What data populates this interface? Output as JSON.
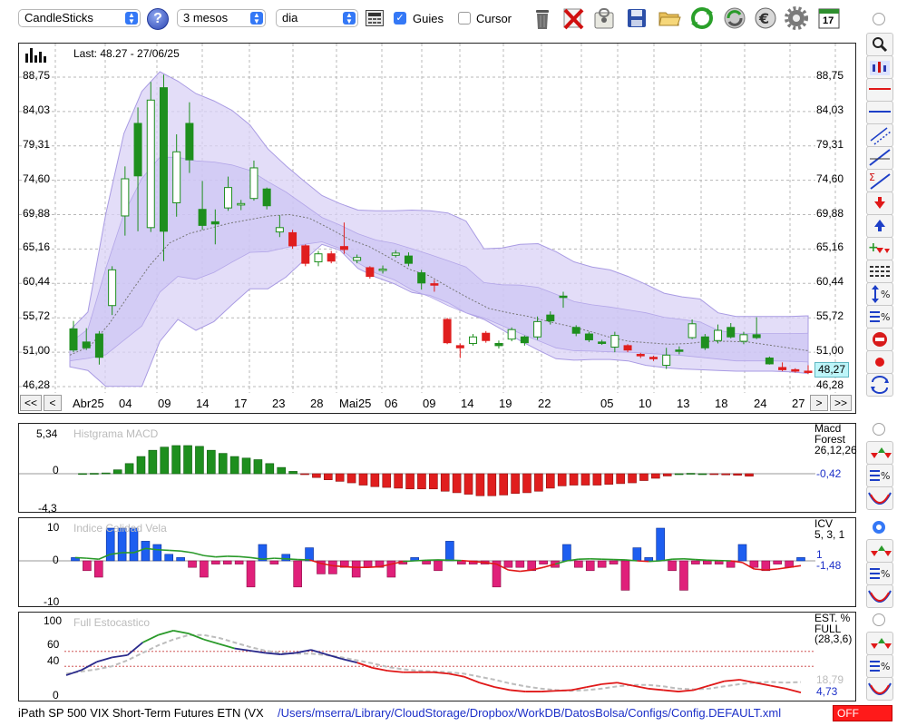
{
  "toolbar": {
    "chart_type": "CandleSticks",
    "period": "3 mesos",
    "interval": "dia",
    "guies_label": "Guies",
    "guies_checked": true,
    "cursor_label": "Cursor",
    "cursor_checked": false,
    "calendar_day": "17",
    "icons": [
      "help-icon",
      "calculator-icon",
      "trash-icon",
      "delete-icon",
      "lock-icon",
      "save-icon",
      "folder-icon",
      "refresh-icon",
      "sync-icon",
      "euro-icon",
      "settings-icon",
      "calendar-icon"
    ]
  },
  "main_panel": {
    "last_label": "Last: 48.27 - 27/06/25",
    "price_ticks": [
      "88,75",
      "84,03",
      "79,31",
      "74,60",
      "69,88",
      "65,16",
      "60,44",
      "55,72",
      "51,00",
      "46,28"
    ],
    "last_price_badge": "48,27",
    "date_labels": [
      "Abr25",
      "04",
      "09",
      "14",
      "17",
      "23",
      "28",
      "Mai25",
      "06",
      "09",
      "14",
      "19",
      "22",
      "05",
      "10",
      "13",
      "18",
      "24",
      "27"
    ],
    "nav": {
      "first": "<<",
      "prev": "<",
      "next": ">",
      "last": ">>"
    }
  },
  "macd_panel": {
    "title": "Histgrama MACD",
    "ticks": [
      "5,34",
      "0",
      "-4,3"
    ],
    "legend_name": "Macd Forest",
    "legend_params": "26,12,26",
    "legend_value": "-0,42"
  },
  "icv_panel": {
    "title": "Indice Calidad Vela",
    "ticks": [
      "10",
      "0",
      "-10"
    ],
    "legend_name": "ICV",
    "legend_params": "5, 3, 1",
    "value_1": "1",
    "value_2": "-1,48"
  },
  "stoch_panel": {
    "title": "Full Estocastico",
    "ticks": [
      "100",
      "60",
      "40",
      "0"
    ],
    "legend_name": "EST. %",
    "legend_type": "FULL",
    "legend_params": "(28,3,6)",
    "value_1": "18,79",
    "value_2": "4,73"
  },
  "status_bar": {
    "instrument": "iPath SP 500 VIX Short-Term Futures ETN (VX",
    "path": "/Users/mserra/Library/CloudStorage/Dropbox/WorkDB/DatosBolsa/Configs/Config.DEFAULT.xml",
    "badge": "OFF"
  },
  "colors": {
    "up": "#1e8f1e",
    "down": "#e01e1e",
    "band": "#d9d2f6",
    "band_edge": "#a99be3",
    "accent": "#3478f6"
  },
  "chart_data": [
    {
      "type": "candlestick",
      "title": "Last: 48.27 - 27/06/25",
      "ylim": [
        46.28,
        90.5
      ],
      "y_ticks": [
        88.75,
        84.03,
        79.31,
        74.6,
        69.88,
        65.16,
        60.44,
        55.72,
        51.0,
        46.28
      ],
      "x_tick_labels": [
        "Abr25",
        "04",
        "09",
        "14",
        "17",
        "23",
        "28",
        "Mai25",
        "06",
        "09",
        "14",
        "19",
        "22",
        "05",
        "10",
        "13",
        "18",
        "24",
        "27"
      ],
      "grid": true,
      "candles": [
        {
          "o": 51.3,
          "c": 54.2,
          "h": 55.3,
          "l": 51.0,
          "t": "g"
        },
        {
          "o": 51.6,
          "c": 52.4,
          "h": 54.3,
          "l": 51.3,
          "t": "g"
        },
        {
          "o": 50.3,
          "c": 53.5,
          "h": 53.9,
          "l": 49.3,
          "t": "g"
        },
        {
          "o": 57.4,
          "c": 62.3,
          "h": 62.8,
          "l": 56.1,
          "t": "w"
        },
        {
          "o": 69.7,
          "c": 74.8,
          "h": 76.5,
          "l": 67.0,
          "t": "w"
        },
        {
          "o": 75.2,
          "c": 82.4,
          "h": 84.6,
          "l": 67.6,
          "t": "g"
        },
        {
          "o": 68.1,
          "c": 85.6,
          "h": 88.1,
          "l": 67.5,
          "t": "w"
        },
        {
          "o": 67.6,
          "c": 87.3,
          "h": 89.1,
          "l": 63.5,
          "t": "g"
        },
        {
          "o": 71.5,
          "c": 78.5,
          "h": 80.9,
          "l": 69.6,
          "t": "w"
        },
        {
          "o": 77.4,
          "c": 82.4,
          "h": 85.3,
          "l": 75.6,
          "t": "g"
        },
        {
          "o": 68.4,
          "c": 70.6,
          "h": 74.5,
          "l": 67.8,
          "t": "g"
        },
        {
          "o": 68.6,
          "c": 68.9,
          "h": 70.6,
          "l": 65.8,
          "t": "g"
        },
        {
          "o": 70.8,
          "c": 73.6,
          "h": 75.1,
          "l": 70.4,
          "t": "w"
        },
        {
          "o": 71.2,
          "c": 71.4,
          "h": 71.9,
          "l": 70.5,
          "t": "w"
        },
        {
          "o": 72.1,
          "c": 76.3,
          "h": 77.3,
          "l": 71.8,
          "t": "w"
        },
        {
          "o": 73.4,
          "c": 71.1,
          "h": 73.6,
          "l": 70.6,
          "t": "g"
        },
        {
          "o": 67.5,
          "c": 68.1,
          "h": 69.8,
          "l": 66.8,
          "t": "w"
        },
        {
          "o": 67.4,
          "c": 65.6,
          "h": 67.8,
          "l": 65.2,
          "t": "r"
        },
        {
          "o": 65.6,
          "c": 63.2,
          "h": 65.8,
          "l": 62.8,
          "t": "r"
        },
        {
          "o": 63.4,
          "c": 64.5,
          "h": 64.9,
          "l": 62.8,
          "t": "w"
        },
        {
          "o": 64.5,
          "c": 63.5,
          "h": 64.9,
          "l": 63.2,
          "t": "r"
        },
        {
          "o": 65.5,
          "c": 65.1,
          "h": 68.8,
          "l": 64.5,
          "t": "r"
        },
        {
          "o": 63.6,
          "c": 64.0,
          "h": 64.4,
          "l": 63.2,
          "t": "w"
        },
        {
          "o": 62.6,
          "c": 61.4,
          "h": 62.8,
          "l": 61.1,
          "t": "r"
        },
        {
          "o": 62.3,
          "c": 62.4,
          "h": 62.9,
          "l": 61.8,
          "t": "w"
        },
        {
          "o": 64.3,
          "c": 64.6,
          "h": 65.0,
          "l": 64.0,
          "t": "w"
        },
        {
          "o": 64.2,
          "c": 63.2,
          "h": 64.7,
          "l": 62.8,
          "t": "g"
        },
        {
          "o": 61.9,
          "c": 60.5,
          "h": 62.3,
          "l": 59.6,
          "t": "g"
        },
        {
          "o": 60.4,
          "c": 60.2,
          "h": 60.9,
          "l": 59.3,
          "t": "r"
        },
        {
          "o": 55.5,
          "c": 52.3,
          "h": 55.7,
          "l": 52.1,
          "t": "r"
        },
        {
          "o": 51.9,
          "c": 51.6,
          "h": 52.2,
          "l": 50.2,
          "t": "r"
        },
        {
          "o": 52.2,
          "c": 53.1,
          "h": 53.5,
          "l": 51.9,
          "t": "w"
        },
        {
          "o": 53.6,
          "c": 52.6,
          "h": 53.9,
          "l": 52.3,
          "t": "r"
        },
        {
          "o": 51.9,
          "c": 52.2,
          "h": 52.6,
          "l": 51.5,
          "t": "g"
        },
        {
          "o": 52.8,
          "c": 54.1,
          "h": 54.4,
          "l": 52.5,
          "t": "w"
        },
        {
          "o": 53.1,
          "c": 52.3,
          "h": 53.3,
          "l": 51.9,
          "t": "g"
        },
        {
          "o": 53.1,
          "c": 55.2,
          "h": 55.9,
          "l": 52.7,
          "t": "w"
        },
        {
          "o": 56.1,
          "c": 55.3,
          "h": 56.6,
          "l": 54.8,
          "t": "g"
        },
        {
          "o": 58.7,
          "c": 58.6,
          "h": 59.3,
          "l": 57.1,
          "t": "g"
        },
        {
          "o": 54.4,
          "c": 53.6,
          "h": 54.7,
          "l": 53.2,
          "t": "g"
        },
        {
          "o": 53.5,
          "c": 52.7,
          "h": 53.8,
          "l": 52.4,
          "t": "g"
        },
        {
          "o": 52.4,
          "c": 52.2,
          "h": 52.7,
          "l": 52.0,
          "t": "g"
        },
        {
          "o": 51.7,
          "c": 53.3,
          "h": 53.8,
          "l": 51.0,
          "t": "w"
        },
        {
          "o": 51.9,
          "c": 51.3,
          "h": 52.1,
          "l": 51.0,
          "t": "r"
        },
        {
          "o": 50.7,
          "c": 50.5,
          "h": 50.9,
          "l": 50.2,
          "t": "r"
        },
        {
          "o": 50.3,
          "c": 50.1,
          "h": 50.5,
          "l": 49.8,
          "t": "r"
        },
        {
          "o": 49.2,
          "c": 50.6,
          "h": 51.6,
          "l": 48.7,
          "t": "w"
        },
        {
          "o": 51.2,
          "c": 51.3,
          "h": 51.8,
          "l": 50.7,
          "t": "g"
        },
        {
          "o": 53.0,
          "c": 54.9,
          "h": 55.5,
          "l": 52.8,
          "t": "w"
        },
        {
          "o": 53.1,
          "c": 51.6,
          "h": 53.5,
          "l": 51.3,
          "t": "g"
        },
        {
          "o": 52.6,
          "c": 54.0,
          "h": 54.8,
          "l": 52.2,
          "t": "w"
        },
        {
          "o": 54.4,
          "c": 53.1,
          "h": 55.0,
          "l": 52.9,
          "t": "g"
        },
        {
          "o": 52.5,
          "c": 53.4,
          "h": 53.8,
          "l": 52.1,
          "t": "w"
        },
        {
          "o": 53.4,
          "c": 53.0,
          "h": 55.8,
          "l": 52.8,
          "t": "g"
        },
        {
          "o": 50.2,
          "c": 49.4,
          "h": 50.4,
          "l": 49.3,
          "t": "g"
        },
        {
          "o": 48.9,
          "c": 48.6,
          "h": 49.6,
          "l": 48.4,
          "t": "r"
        },
        {
          "o": 48.6,
          "c": 48.4,
          "h": 48.8,
          "l": 48.2,
          "t": "r"
        },
        {
          "o": 48.4,
          "c": 48.3,
          "h": 49.2,
          "l": 48.0,
          "t": "r"
        }
      ],
      "bands": {
        "upper": [
          54.0,
          56.5,
          70.0,
          81.0,
          86.8,
          89.5,
          88.2,
          86.5,
          85.5,
          84.2,
          82.2,
          78.9,
          76.6,
          74.5,
          72.5,
          71.4,
          70.5,
          70.4,
          70.4,
          70.5,
          70.4,
          70.1,
          69.0,
          65.2,
          65.3,
          65.8,
          65.9,
          64.8,
          63.4,
          62.7,
          62.3,
          61.4,
          60.3,
          59.1,
          58.6,
          58.3,
          56.4,
          55.9,
          55.9,
          55.9,
          55.9,
          56.0
        ],
        "lower": [
          49.0,
          48.5,
          46.3,
          46.3,
          46.3,
          52.5,
          55.5,
          54.0,
          55.2,
          57.5,
          59.7,
          59.7,
          61.3,
          63.6,
          65.8,
          65.0,
          62.5,
          61.3,
          60.4,
          59.2,
          58.8,
          57.8,
          56.4,
          55.5,
          54.1,
          52.6,
          51.3,
          50.1,
          49.9,
          50.0,
          50.0,
          49.8,
          49.2,
          48.9,
          48.7,
          48.6,
          48.5,
          48.4,
          48.4,
          48.4,
          48.3,
          48.1
        ],
        "mid": [
          50.6,
          51.8,
          55.0,
          59.0,
          62.9,
          66.0,
          67.3,
          68.0,
          68.7,
          69.2,
          69.7,
          69.9,
          69.4,
          68.0,
          66.5,
          65.5,
          64.0,
          62.4,
          61.5,
          59.9,
          58.4,
          57.0,
          56.4,
          55.9,
          55.2,
          54.6,
          53.9,
          53.1,
          52.5,
          52.3,
          52.1,
          52.2,
          52.5,
          52.5,
          52.4,
          52.0,
          51.6,
          51.2
        ]
      }
    },
    {
      "type": "bar",
      "title": "Histgrama MACD",
      "ylim": [
        -4.3,
        5.34
      ],
      "values": [
        0.02,
        0.05,
        0.1,
        0.5,
        1.3,
        2.2,
        3.0,
        3.4,
        3.6,
        3.6,
        3.5,
        3.0,
        2.6,
        2.2,
        2.0,
        1.8,
        1.3,
        0.8,
        0.3,
        -0.1,
        -0.5,
        -0.8,
        -1.0,
        -1.2,
        -1.5,
        -1.7,
        -1.8,
        -1.9,
        -2.0,
        -2.0,
        -2.0,
        -2.3,
        -2.5,
        -2.7,
        -2.9,
        -2.9,
        -2.8,
        -2.6,
        -2.5,
        -2.3,
        -1.9,
        -1.6,
        -1.5,
        -1.5,
        -1.5,
        -1.4,
        -1.3,
        -1.2,
        -0.9,
        -0.6,
        -0.3,
        0.0,
        0.05,
        0.0,
        -0.08,
        -0.15,
        -0.2,
        -0.33
      ],
      "legend": [
        "Macd Forest 26,12,26"
      ],
      "last_value": -0.42
    },
    {
      "type": "bar+line",
      "title": "Indice Calidad Vela",
      "ylim": [
        -10,
        10
      ],
      "bars": [
        1,
        -3,
        -5,
        10,
        10,
        10,
        6,
        5,
        2,
        1,
        -2,
        -5,
        -1,
        -1,
        -1,
        -8,
        5,
        -1,
        2,
        -8,
        4,
        -4,
        -4,
        -2,
        -5,
        -2,
        -2,
        -5,
        -1,
        1,
        -1,
        -3,
        6,
        -1,
        -1,
        -1,
        -8,
        -2,
        -2,
        -3,
        -1,
        -2,
        5,
        -2,
        -3,
        -2,
        -1,
        -9,
        4,
        1,
        10,
        -3,
        -9,
        -1,
        -1,
        -1,
        -2,
        5,
        -2,
        -3,
        -1,
        -2,
        1
      ],
      "line": [
        1.0,
        0.8,
        0.5,
        2.0,
        2.5,
        2.5,
        3.8,
        3.4,
        3.2,
        3.0,
        2.5,
        1.6,
        1.2,
        1.4,
        1.3,
        1.0,
        0.5,
        0.8,
        0.6,
        0.4,
        0.3,
        -0.8,
        -1.5,
        -1.8,
        -2.0,
        -2.0,
        -1.8,
        -1.0,
        -0.2,
        0.0,
        0.2,
        0.3,
        0.2,
        0.1,
        -0.2,
        -0.5,
        -1.0,
        -2.8,
        -3.2,
        -2.8,
        -2.0,
        -1.0,
        0.0,
        0.5,
        0.6,
        0.5,
        0.4,
        0.3,
        0.0,
        -0.2,
        0.0,
        0.5,
        0.6,
        0.4,
        0.2,
        0.1,
        0.0,
        -0.5,
        -2.5,
        -2.8,
        -2.5,
        -2.0,
        -1.48
      ],
      "legend": [
        "ICV 5, 3, 1"
      ],
      "last_values": [
        1,
        -1.48
      ]
    },
    {
      "type": "line",
      "title": "Full Estocastico",
      "ylim": [
        0,
        100
      ],
      "y_ticks": [
        100,
        60,
        40,
        0
      ],
      "reference_lines": [
        60,
        40
      ],
      "series": [
        {
          "name": "%K",
          "values": [
            28,
            35,
            46,
            52,
            55,
            72,
            82,
            88,
            84,
            76,
            70,
            64,
            61,
            58,
            56,
            58,
            62,
            56,
            50,
            45,
            38,
            34,
            32,
            32,
            32,
            30,
            26,
            18,
            12,
            8,
            6,
            6,
            7,
            8,
            12,
            16,
            18,
            14,
            10,
            8,
            6,
            8,
            14,
            20,
            22,
            18,
            14,
            10,
            4.73
          ]
        },
        {
          "name": "%D",
          "values": [
            30,
            33,
            36,
            40,
            48,
            58,
            68,
            76,
            82,
            82,
            78,
            72,
            66,
            61,
            58,
            57,
            57,
            55,
            52,
            48,
            44,
            39,
            36,
            34,
            33,
            32,
            30,
            26,
            22,
            17,
            13,
            10,
            8,
            7,
            8,
            10,
            13,
            15,
            15,
            13,
            10,
            9,
            10,
            13,
            16,
            18,
            19,
            18,
            18.79
          ]
        }
      ],
      "legend": [
        "EST. % FULL (28,3,6)"
      ],
      "last_values": [
        18.79,
        4.73
      ]
    }
  ]
}
